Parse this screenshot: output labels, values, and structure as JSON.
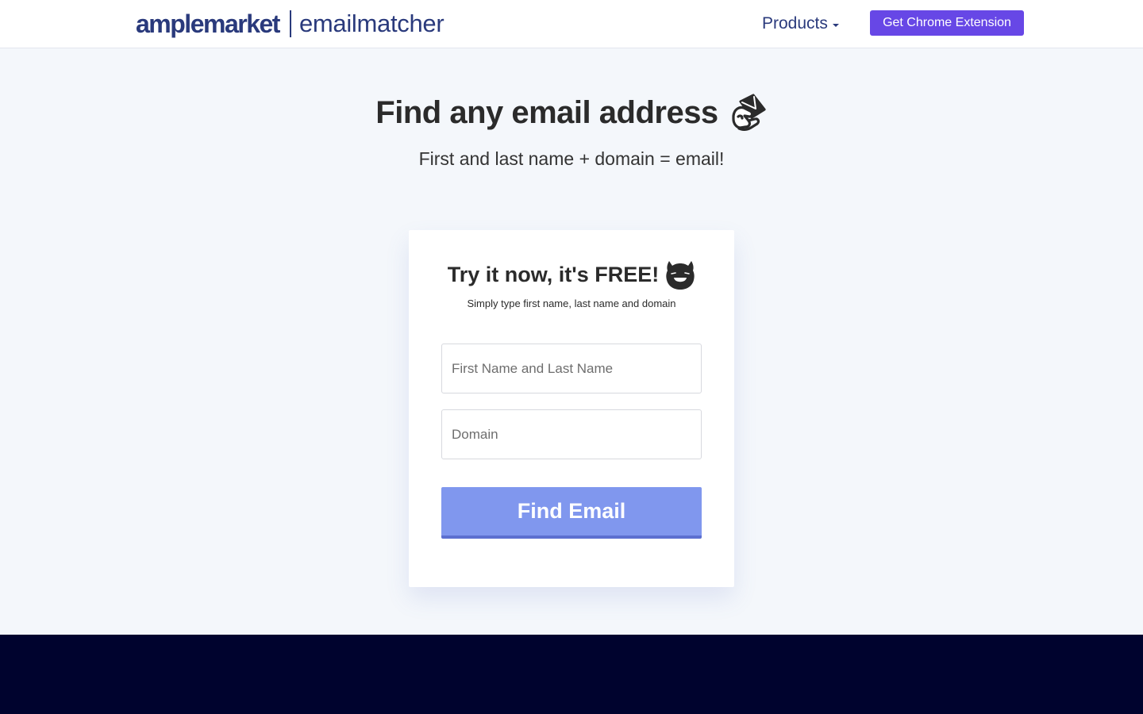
{
  "header": {
    "brand_main": "amplemarket",
    "brand_sub": "emailmatcher",
    "nav_products": "Products",
    "cta_label": "Get Chrome Extension"
  },
  "hero": {
    "title": "Find any email address",
    "subtitle": "First and last name + domain = email!",
    "title_icon": "mail-envelope-hand-icon"
  },
  "card": {
    "title": "Try it now, it's FREE!",
    "title_icon": "smiling-face-icon",
    "subtitle": "Simply type first name, last name and domain",
    "name_placeholder": "First Name and Last Name",
    "domain_placeholder": "Domain",
    "button_label": "Find Email"
  },
  "colors": {
    "brand": "#2a3a7c",
    "cta": "#6747e6",
    "button": "#8097ee",
    "footer": "#00032e",
    "page_bg": "#f4f7fb"
  }
}
